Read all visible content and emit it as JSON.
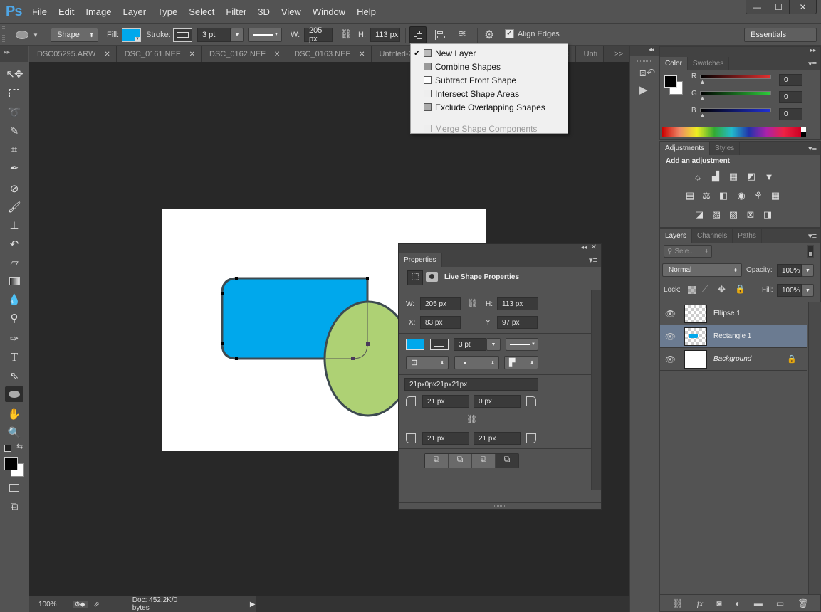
{
  "app": {
    "logo": "Ps"
  },
  "menubar": {
    "items": [
      "File",
      "Edit",
      "Image",
      "Layer",
      "Type",
      "Select",
      "Filter",
      "3D",
      "View",
      "Window",
      "Help"
    ]
  },
  "window_controls": {
    "minimize": "—",
    "maximize": "☐",
    "close": "✕"
  },
  "options_bar": {
    "tool_mode": "Shape",
    "fill_label": "Fill:",
    "fill_color": "#00a8ec",
    "stroke_label": "Stroke:",
    "stroke_width": "3 pt",
    "w_label": "W:",
    "w_value": "205 px",
    "h_label": "H:",
    "h_value": "113 px",
    "align_edges_label": "Align Edges",
    "align_edges_checked": true,
    "workspace": "Essentials"
  },
  "doc_tabs": [
    {
      "name": "DSC05295.ARW"
    },
    {
      "name": "DSC_0161.NEF"
    },
    {
      "name": "DSC_0162.NEF"
    },
    {
      "name": "DSC_0163.NEF"
    },
    {
      "name": "Untitled-2..."
    },
    {
      "name": ""
    },
    {
      "name": "Unti"
    }
  ],
  "tab_overflow": ">>",
  "path_ops_menu": {
    "items": [
      {
        "label": "New Layer",
        "checked": true,
        "disabled": false
      },
      {
        "label": "Combine Shapes",
        "checked": false,
        "disabled": false
      },
      {
        "label": "Subtract Front Shape",
        "checked": false,
        "disabled": false
      },
      {
        "label": "Intersect Shape Areas",
        "checked": false,
        "disabled": false
      },
      {
        "label": "Exclude Overlapping Shapes",
        "checked": false,
        "disabled": false
      }
    ],
    "merge": {
      "label": "Merge Shape Components",
      "disabled": true
    }
  },
  "canvas": {
    "rect_fill": "#00a8ec",
    "ellipse_fill": "#aed174",
    "stroke_color": "#3d4a50"
  },
  "status": {
    "zoom": "100%",
    "doc": "Doc: 452.2K/0 bytes"
  },
  "color_panel": {
    "tabs": [
      "Color",
      "Swatches"
    ],
    "r_label": "R",
    "r_value": "0",
    "g_label": "G",
    "g_value": "0",
    "b_label": "B",
    "b_value": "0"
  },
  "adjustments_panel": {
    "tabs": [
      "Adjustments",
      "Styles"
    ],
    "heading": "Add an adjustment"
  },
  "layers_panel": {
    "tabs": [
      "Layers",
      "Channels",
      "Paths"
    ],
    "filter_placeholder": "Sele...",
    "blend_mode": "Normal",
    "opacity_label": "Opacity:",
    "opacity_value": "100%",
    "lock_label": "Lock:",
    "fill_label": "Fill:",
    "fill_value": "100%",
    "layers": [
      {
        "name": "Ellipse 1",
        "selected": false,
        "locked": false
      },
      {
        "name": "Rectangle 1",
        "selected": true,
        "locked": false
      },
      {
        "name": "Background",
        "selected": false,
        "locked": true
      }
    ]
  },
  "properties_panel": {
    "title": "Properties",
    "subtitle": "Live Shape Properties",
    "w_label": "W:",
    "w_value": "205 px",
    "h_label": "H:",
    "h_value": "113 px",
    "x_label": "X:",
    "x_value": "83 px",
    "y_label": "Y:",
    "y_value": "97 px",
    "fill_color": "#00a8ec",
    "stroke_width": "3 pt",
    "corner_summary": "21px0px21px21px",
    "corner_tl": "21 px",
    "corner_tr": "0 px",
    "corner_bl": "21 px",
    "corner_br": "21 px"
  }
}
